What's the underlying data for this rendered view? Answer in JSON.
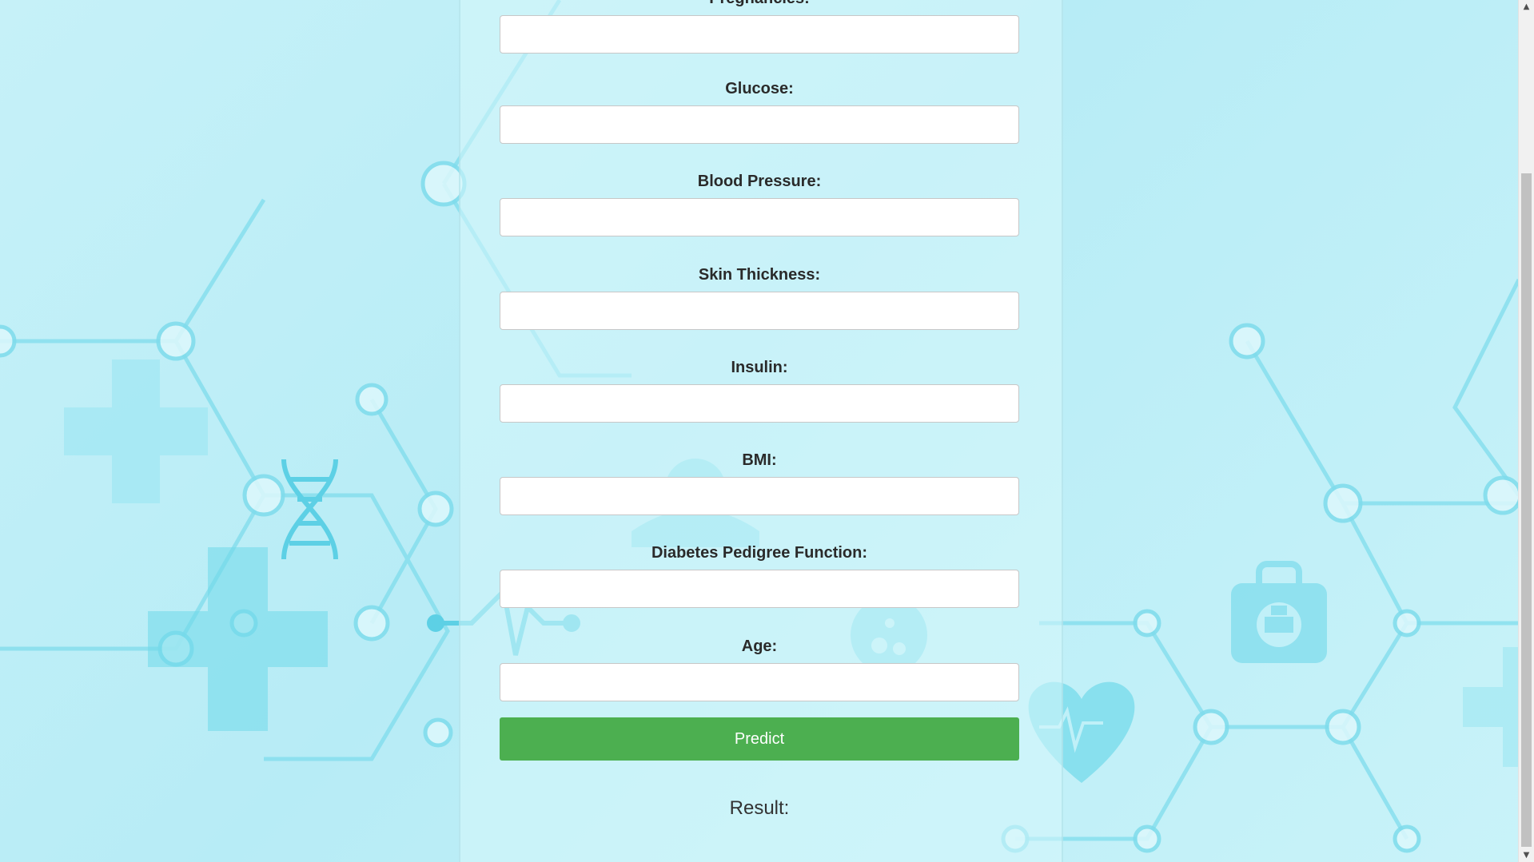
{
  "fields": [
    {
      "label": "Pregnancies:",
      "value": ""
    },
    {
      "label": "Glucose:",
      "value": ""
    },
    {
      "label": "Blood Pressure:",
      "value": ""
    },
    {
      "label": "Skin Thickness:",
      "value": ""
    },
    {
      "label": "Insulin:",
      "value": ""
    },
    {
      "label": "BMI:",
      "value": ""
    },
    {
      "label": "Diabetes Pedigree Function:",
      "value": ""
    },
    {
      "label": "Age:",
      "value": ""
    }
  ],
  "predict_label": "Predict",
  "result_label": "Result:",
  "colors": {
    "background": "#bff0f8",
    "accent": "#4caf50",
    "art": "#6fd8ea"
  },
  "icons": [
    "dna-icon",
    "heart-pulse-icon",
    "medical-kit-icon",
    "flask-icon",
    "doctor-icon",
    "medical-cross-icon"
  ]
}
